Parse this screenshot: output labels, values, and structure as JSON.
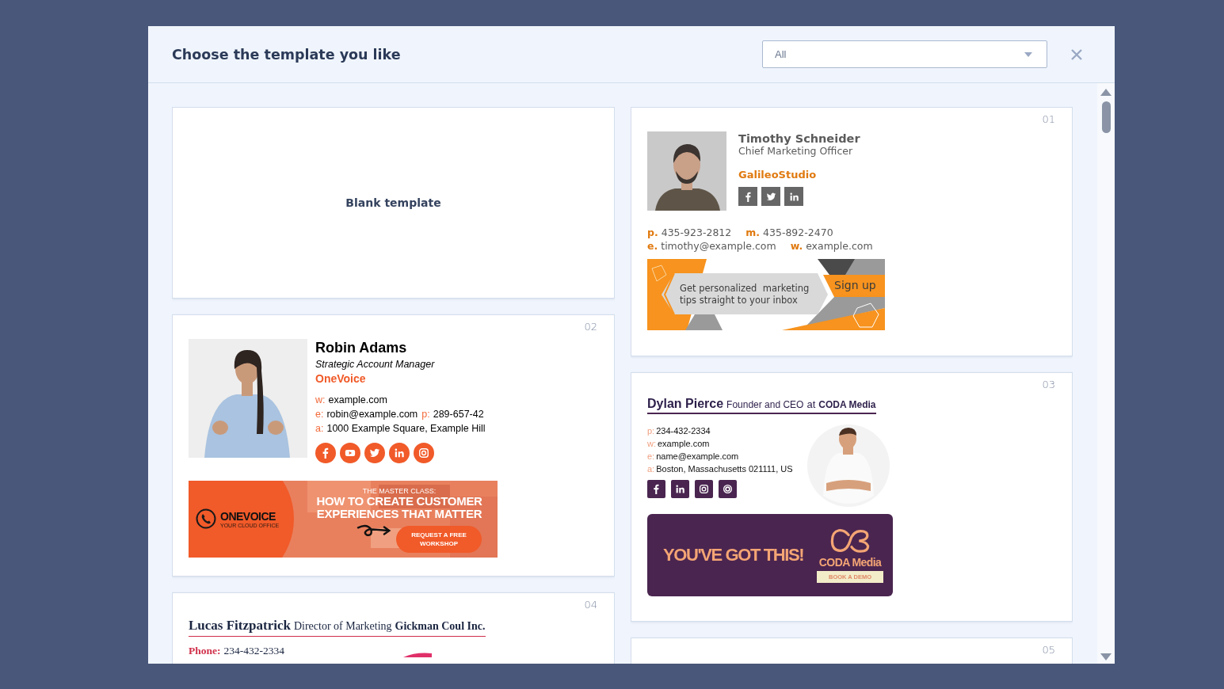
{
  "dialog": {
    "title": "Choose the template you like",
    "filter": {
      "value": "All"
    }
  },
  "columns": [
    {
      "cards": [
        {
          "kind": "blank",
          "label": "Blank template"
        },
        {
          "kind": "onevoice",
          "number": "02",
          "name": "Robin Adams",
          "title": "Strategic Account Manager",
          "company": "OneVoice",
          "contact_rows": [
            [
              {
                "label": "w:",
                "value": "example.com"
              }
            ],
            [
              {
                "label": "e:",
                "value": "robin@example.com"
              },
              {
                "label": "p:",
                "value": "289-657-42"
              }
            ],
            [
              {
                "label": "a:",
                "value": "1000 Example Square, Example Hill"
              }
            ]
          ],
          "banner": {
            "brand": "ONEVOICE",
            "tagline": "YOUR CLOUD OFFICE",
            "kicker": "THE MASTER CLASS:",
            "headline": [
              "HOW TO CREATE CUSTOMER",
              "EXPERIENCES THAT MATTER"
            ],
            "button": "REQUEST A FREE WORKSHOP"
          }
        },
        {
          "kind": "classic",
          "number": "04",
          "name": "Lucas Fitzpatrick",
          "title": "Director of Marketing",
          "company": "Gickman Coul Inc.",
          "contact_rows": [
            [
              {
                "label": "Phone:",
                "value": "234-432-2334"
              }
            ]
          ]
        }
      ]
    },
    {
      "cards": [
        {
          "kind": "galileo",
          "number": "01",
          "name": "Timothy Schneider",
          "title": "Chief Marketing Officer",
          "company": "GalileoStudio",
          "contact_rows": [
            [
              {
                "label": "p.",
                "value": "435-923-2812"
              },
              {
                "label": "m.",
                "value": "435-892-2470"
              }
            ],
            [
              {
                "label": "e.",
                "value": "timothy@example.com"
              },
              {
                "label": "w.",
                "value": "example.com"
              }
            ]
          ],
          "banner": {
            "lines": [
              "Get personalized  marketing",
              "tips straight to your inbox"
            ],
            "button": "Sign up"
          }
        },
        {
          "kind": "coda",
          "number": "03",
          "name": "Dylan Pierce",
          "title": "Founder and CEO",
          "joiner": "at",
          "company": "CODA Media",
          "contact_rows": [
            [
              {
                "label": "p:",
                "value": "234-432-2334"
              }
            ],
            [
              {
                "label": "w:",
                "value": "example.com"
              }
            ],
            [
              {
                "label": "e:",
                "value": "name@example.com"
              }
            ],
            [
              {
                "label": "a:",
                "value": "Boston, Massachusetts 021111, US"
              }
            ]
          ],
          "banner": {
            "headline": "YOU'VE GOT THIS!",
            "brand": "CODA Media",
            "button": "BOOK A DEMO"
          }
        },
        {
          "kind": "empty",
          "number": "05"
        }
      ]
    }
  ]
}
